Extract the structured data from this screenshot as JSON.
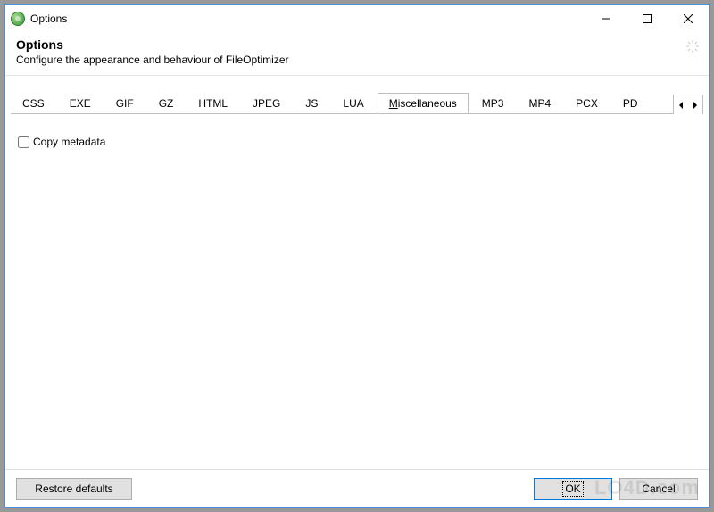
{
  "window": {
    "title": "Options"
  },
  "header": {
    "title": "Options",
    "subtitle": "Configure the appearance and behaviour of FileOptimizer"
  },
  "tabs": {
    "items": [
      {
        "label": "CSS",
        "active": false
      },
      {
        "label": "EXE",
        "active": false
      },
      {
        "label": "GIF",
        "active": false
      },
      {
        "label": "GZ",
        "active": false
      },
      {
        "label": "HTML",
        "active": false
      },
      {
        "label": "JPEG",
        "active": false
      },
      {
        "label": "JS",
        "active": false
      },
      {
        "label": "LUA",
        "active": false
      },
      {
        "label": "Miscellaneous",
        "active": true,
        "mnemonic_index": 0
      },
      {
        "label": "MP3",
        "active": false
      },
      {
        "label": "MP4",
        "active": false
      },
      {
        "label": "PCX",
        "active": false
      },
      {
        "label": "PD",
        "active": false,
        "partial": true
      }
    ],
    "scroll_left": "◂",
    "scroll_right": "▸"
  },
  "content": {
    "copy_metadata_label": "Copy metadata",
    "copy_metadata_checked": false
  },
  "buttons": {
    "restore_defaults": "Restore defaults",
    "ok": "OK",
    "cancel": "Cancel"
  },
  "watermark": "LO4D.com"
}
